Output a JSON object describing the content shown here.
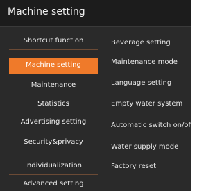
{
  "header": {
    "title": "Machine setting"
  },
  "sidebar": {
    "items": [
      {
        "label": "Shortcut function",
        "active": false
      },
      {
        "label": "Machine setting",
        "active": true
      },
      {
        "label": "Maintenance",
        "active": false
      },
      {
        "label": "Statistics",
        "active": false
      },
      {
        "label": "Advertising setting",
        "active": false
      },
      {
        "label": "Security&privacy",
        "active": false
      },
      {
        "label": "Individualization",
        "active": false
      },
      {
        "label": "Advanced setting",
        "active": false
      }
    ]
  },
  "main": {
    "options": [
      "Beverage setting",
      "Maintenance mode",
      "Language setting",
      "Empty water system",
      "Automatic switch on/off",
      "Water supply mode",
      "Factory reset"
    ]
  },
  "colors": {
    "accent": "#ef7a2a",
    "background": "#2a2a2a",
    "header": "#1c1c1c",
    "divider": "#6b4a35",
    "text": "#eeeeee"
  }
}
